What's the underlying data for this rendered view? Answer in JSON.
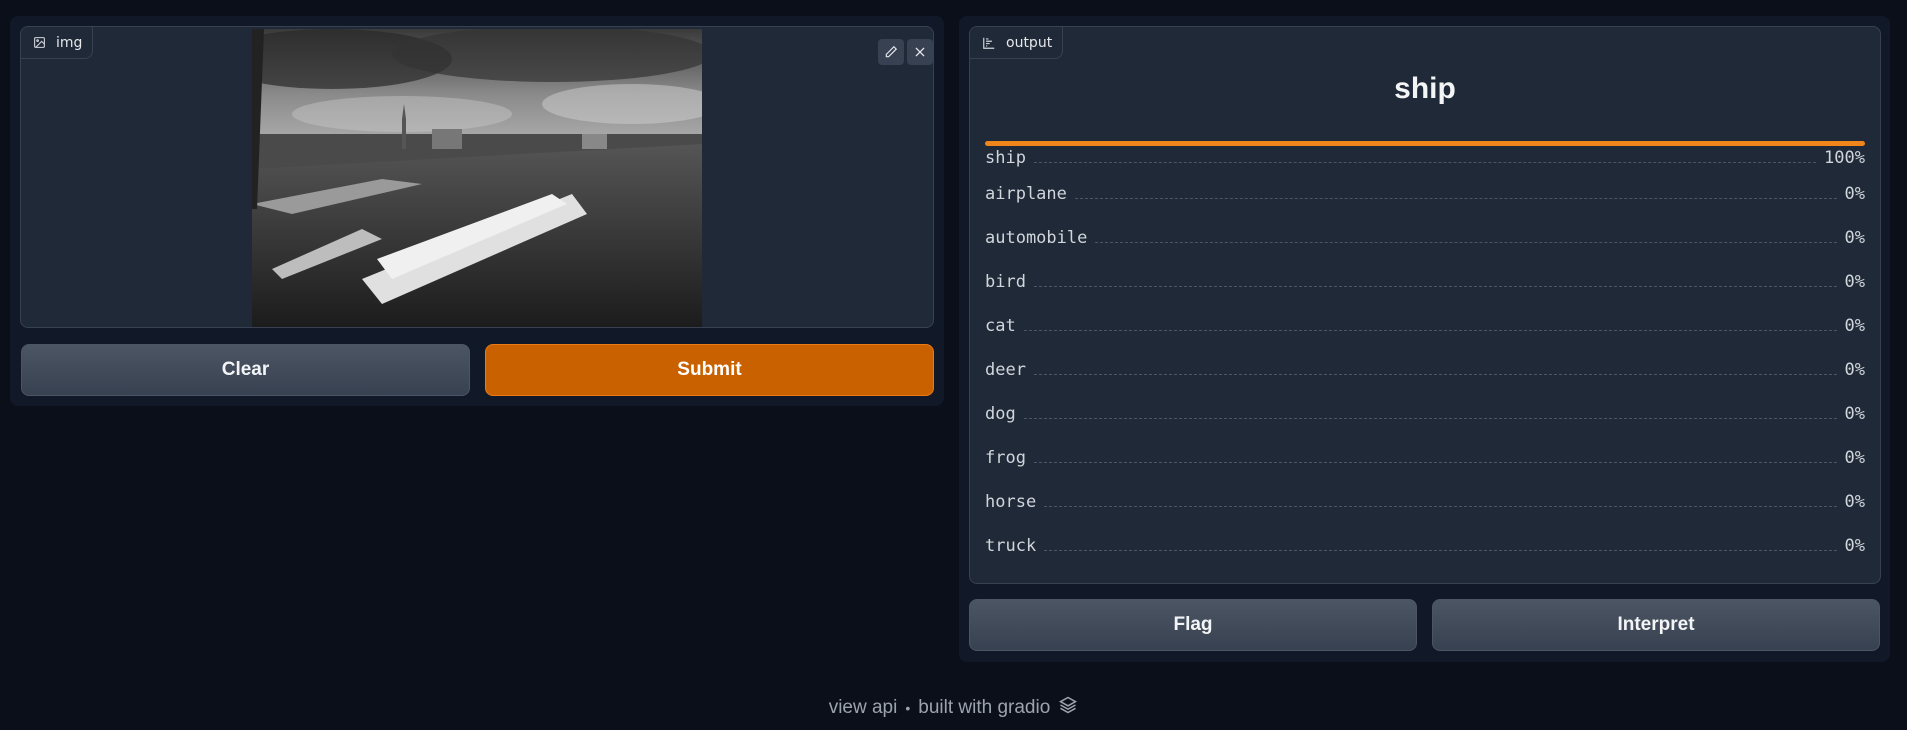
{
  "input": {
    "label": "img",
    "icons": {
      "label_icon": "image-icon",
      "edit": "pencil-icon",
      "close": "close-icon"
    }
  },
  "buttons": {
    "clear": "Clear",
    "submit": "Submit",
    "flag": "Flag",
    "interpret": "Interpret"
  },
  "output": {
    "label": "output",
    "label_icon": "bar-chart-icon",
    "prediction": "ship",
    "top_confidence": 1.0,
    "confidences": [
      {
        "label": "ship",
        "value": "100%"
      },
      {
        "label": "airplane",
        "value": "0%"
      },
      {
        "label": "automobile",
        "value": "0%"
      },
      {
        "label": "bird",
        "value": "0%"
      },
      {
        "label": "cat",
        "value": "0%"
      },
      {
        "label": "deer",
        "value": "0%"
      },
      {
        "label": "dog",
        "value": "0%"
      },
      {
        "label": "frog",
        "value": "0%"
      },
      {
        "label": "horse",
        "value": "0%"
      },
      {
        "label": "truck",
        "value": "0%"
      }
    ]
  },
  "footer": {
    "view_api": "view api",
    "separator": "•",
    "built_with": "built with gradio",
    "logo_icon": "gradio-logo-icon"
  },
  "colors": {
    "accent": "#f0851c",
    "primary_button": "#c96100",
    "background": "#0b0f19"
  }
}
